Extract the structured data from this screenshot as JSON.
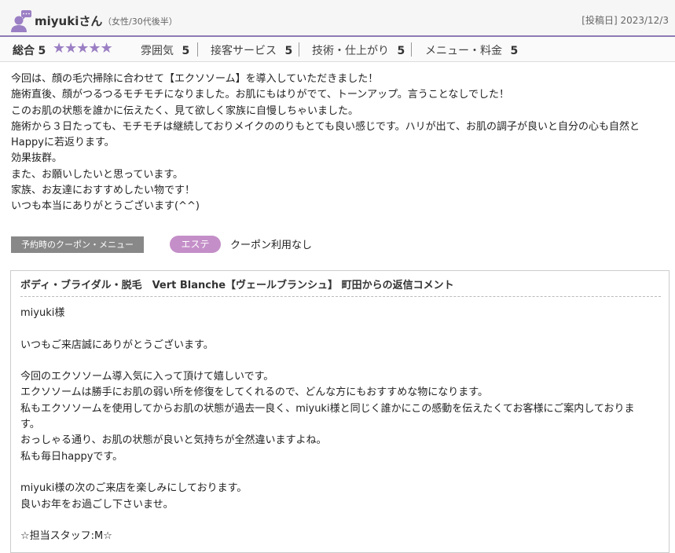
{
  "header": {
    "username": "miyukiさん",
    "user_info": "（女性/30代後半）",
    "posted_label": "[投稿日] 2023/12/3"
  },
  "ratings": {
    "overall_label": "総合",
    "overall_value": "5",
    "stars": "★★★★★",
    "items": [
      {
        "label": "雰囲気",
        "value": "5"
      },
      {
        "label": "接客サービス",
        "value": "5"
      },
      {
        "label": "技術・仕上がり",
        "value": "5"
      },
      {
        "label": "メニュー・料金",
        "value": "5"
      }
    ]
  },
  "review": {
    "lines": [
      "今回は、顔の毛穴掃除に合わせて【エクソソーム】を導入していただきました！",
      "施術直後、顔がつるつるモチモチになりました。お肌にもはりがでて、トーンアップ。言うことなしでした！",
      "このお肌の状態を誰かに伝えたく、見て欲しく家族に自慢しちゃいました。",
      "施術から３日たっても、モチモチは継続しておりメイクののりもとても良い感じです。ハリが出て、お肌の調子が良いと自分の心も自然と",
      "Happyに若返ります。",
      "効果抜群。",
      "また、お願いしたいと思っています。",
      "家族、お友達におすすめしたい物です！",
      "いつも本当にありがとうございます(^^)"
    ]
  },
  "coupon": {
    "label": "予約時のクーポン・メニュー",
    "tag": "エステ",
    "value": "クーポン利用なし"
  },
  "reply": {
    "title": "ボディ・ブライダル・脱毛　Vert Blanche【ヴェールブランシュ】 町田からの返信コメント",
    "lines": [
      "miyuki様",
      "",
      "いつもご来店誠にありがとうございます。",
      "",
      "今回のエクソソーム導入気に入って頂けて嬉しいです。",
      "エクソソームは勝手にお肌の弱い所を修復をしてくれるので、どんな方にもおすすめな物になります。",
      "私もエクソソームを使用してからお肌の状態が過去一良く、miyuki様と同じく誰かにこの感動を伝えたくてお客様にご案内しておりま",
      "す。",
      "おっしゃる通り、お肌の状態が良いと気持ちが全然違いますよね。",
      "私も毎日happyです。",
      "",
      "miyuki様の次のご来店を楽しみにしております。",
      "良いお年をお過ごし下さいませ。",
      "",
      "☆担当スタッフ:M☆"
    ]
  },
  "colors": {
    "accent": "#8f7bb6",
    "star": "#9b7fc4",
    "tag_bg": "#c48fc8",
    "label_bg": "#888888"
  },
  "icons": {
    "avatar": "user-avatar-icon"
  }
}
